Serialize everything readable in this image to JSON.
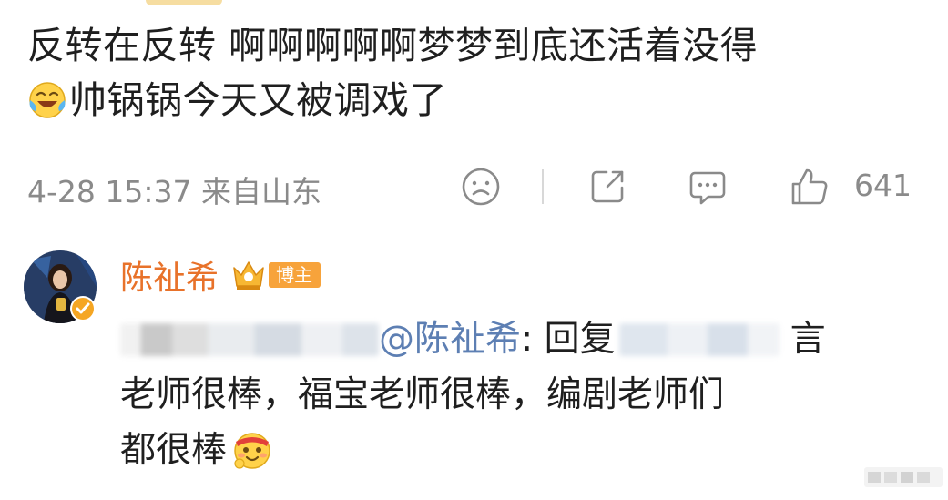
{
  "post": {
    "line1": "反转在反转 啊啊啊啊啊梦梦到底还活着没得",
    "line2_emoji": "laughing-tears-icon",
    "line2_text": "帅锅锅今天又被调戏了",
    "time_location": "4-28 15:37 来自山东",
    "actions": {
      "dislike_icon": "sad-face-icon",
      "share_icon": "share-icon",
      "comment_icon": "comment-icon",
      "like_icon": "thumbs-up-icon",
      "like_count": "641"
    }
  },
  "comment": {
    "user_name": "陈祉希",
    "crown_icon": "crown-badge-icon",
    "role_badge": "博主",
    "mention": "@陈祉希",
    "reply_sep": ": ",
    "reply_word": "回复",
    "line1_tail": "言",
    "line2": "老师很棒，福宝老师很棒，编剧老师们",
    "line3": "都很棒",
    "end_emoji": "happy-face-icon"
  },
  "colors": {
    "name": "#e8722a",
    "mention": "#5d7fb3",
    "meta": "#8a8a8a",
    "badge": "#f7a33b"
  }
}
